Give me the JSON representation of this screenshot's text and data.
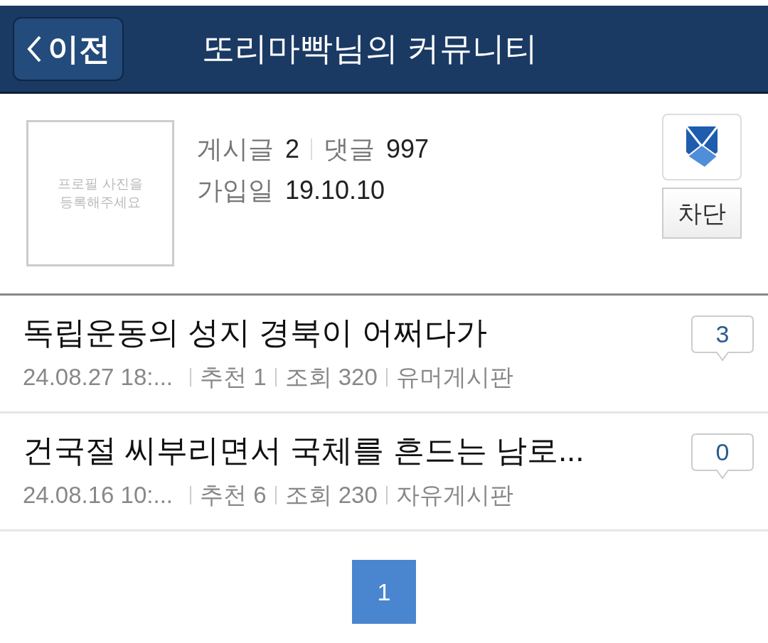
{
  "header": {
    "back_button": "이전",
    "title": "또리마빡님의 커뮤니티"
  },
  "profile": {
    "photo_placeholder": "프로필 사진을 등록해주세요",
    "stats": [
      {
        "label": "게시글",
        "value": "2"
      },
      {
        "label": "댓글",
        "value": "997"
      }
    ],
    "joined": {
      "label": "가입일",
      "value": "19.10.10"
    },
    "block_button": "차단"
  },
  "posts": [
    {
      "title": "독립운동의 성지 경북이 어쩌다가",
      "datetime": "24.08.27  18:...",
      "likes": "추천 1",
      "views": "조회 320",
      "board": "유머게시판",
      "comments": "3"
    },
    {
      "title": "건국절 씨부리면서 국체를 흔드는 남로...",
      "datetime": "24.08.16  10:...",
      "likes": "추천 6",
      "views": "조회 230",
      "board": "자유게시판",
      "comments": "0"
    }
  ],
  "pagination": [
    {
      "label": "1",
      "selected": true
    }
  ]
}
